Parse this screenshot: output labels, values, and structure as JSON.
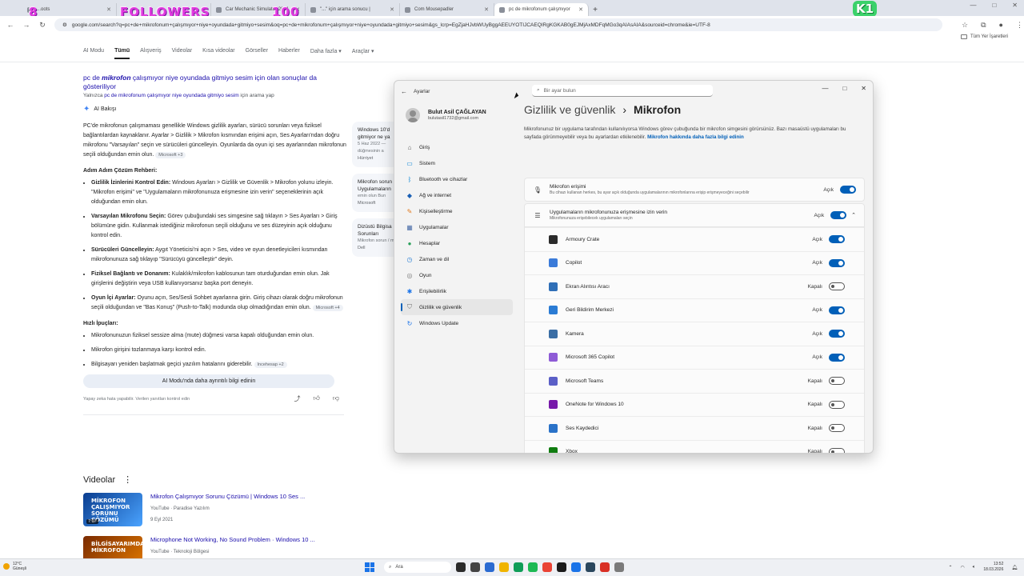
{
  "browser": {
    "tabs": [
      {
        "title": "...oots",
        "active": false
      },
      {
        "title": "Bu...",
        "active": false
      },
      {
        "title": "Car Mechanic Simulator 2021",
        "active": false
      },
      {
        "title": "\"...\" için arama sonucu |",
        "active": false
      },
      {
        "title": "Com Mousepadler",
        "active": false
      },
      {
        "title": "pc de mikrofonum çalışmıyor",
        "active": true
      }
    ],
    "new_tab": "+",
    "url": "google.com/search?q=pc+de+mikrofonum+çalışmıyor+niye+oyundada+gitmiyo+sesim&oq=pc+de+mikrofonum+çalışmıyor+niye+oyundada+gitmiyo+sesim&gs_lcrp=EgZjaHJvbWUyBggAEEUYOTIJCAEQIRgKGKAB0gEJMjAxMDFqMGo3qAIAsAIA&sourceid=chrome&ie=UTF-8",
    "bookmarks_label": "Tüm Yer İşaretleri"
  },
  "overlay": {
    "left_text": "FOLLOWERS",
    "left_num": "8",
    "right_num": "100",
    "k_badge": "K1"
  },
  "google": {
    "nav": [
      "AI Modu",
      "Tümü",
      "Alışveriş",
      "Videolar",
      "Kısa videolar",
      "Görseller",
      "Haberler",
      "Daha fazla ▾",
      "Araçlar ▾"
    ],
    "result_title_pre": "pc de ",
    "result_title_bold": "mikrofon",
    "result_title_post": " çalışmıyor niye oyundada gitmiyo sesim için olan sonuçlar da gösteriliyor",
    "result_sub_pre": "Yalnızca ",
    "result_sub_link": "pc de mikrofonum çalışmıyor niye oyundada gitmiyo sesim",
    "result_sub_post": " için arama yap",
    "ai_label": "AI Bakışı",
    "intro": "PC'de mikrofonun çalışmaması genellikle Windows gizlilik ayarları, sürücü sorunları veya fiziksel bağlantılardan kaynaklanır. Ayarlar > Gizlilik > Mikrofon kısmından erişimi açın, Ses Ayarları'ndan doğru mikrofonu \"Varsayılan\" seçin ve sürücüleri güncelleyin. Oyunlarda da oyun içi ses ayarlarından mikrofonun seçili olduğundan emin olun.",
    "intro_cite": "Microsoft +3",
    "steps_heading": "Adım Adım Çözüm Rehberi:",
    "steps": [
      {
        "bold": "Gizlilik İzinlerini Kontrol Edin:",
        "text": " Windows Ayarları > Gizlilik ve Güvenlik > Mikrofon yolunu izleyin. \"Mikrofon erişimi\" ve \"Uygulamaların mikrofonunuza erişmesine izin verin\" seçeneklerinin açık olduğundan emin olun.",
        "cite": ""
      },
      {
        "bold": "Varsayılan Mikrofonu Seçin:",
        "text": " Görev çubuğundaki ses simgesine sağ tıklayın > Ses Ayarları > Giriş bölümüne gidin. Kullanmak istediğiniz mikrofonun seçili olduğunu ve ses düzeyinin açık olduğunu kontrol edin.",
        "cite": ""
      },
      {
        "bold": "Sürücüleri Güncelleyin:",
        "text": " Aygıt Yöneticisi'ni açın > Ses, video ve oyun denetleyicileri kısmından mikrofonunuza sağ tıklayıp \"Sürücüyü güncelleştir\" deyin.",
        "cite": ""
      },
      {
        "bold": "Fiziksel Bağlantı ve Donanım:",
        "text": " Kulaklık/mikrofon kablosunun tam oturduğundan emin olun. Jak girişlerini değiştirin veya USB kullanıyorsanız başka port deneyin.",
        "cite": ""
      },
      {
        "bold": "Oyun İçi Ayarlar:",
        "text": " Oyunu açın, Ses/Sesli Sohbet ayarlarına girin. Giriş cihazı olarak doğru mikrofonun seçili olduğundan ve \"Bas Konuş\" (Push-to-Talk) modunda olup olmadığından emin olun.",
        "cite": "Microsoft +4"
      }
    ],
    "tips_heading": "Hızlı İpuçları:",
    "tips": [
      {
        "text": "Mikrofonunuzun fiziksel sessize alma (mute) düğmesi varsa kapalı olduğundan emin olun.",
        "cite": ""
      },
      {
        "text": "Mikrofon girişini tozlanmaya karşı kontrol edin.",
        "cite": ""
      },
      {
        "text": "Bilgisayarı yeniden başlatmak geçici yazılım hatalarını giderebilir.",
        "cite": "Incehesap +2"
      }
    ],
    "ai_more": "AI Modu'nda daha ayrıntılı bilgi edinin",
    "ai_disclaimer": "Yapay zeka hata yapabilir. Verilen yanıtları kontrol edin",
    "side_cards": [
      {
        "title": "Windows 10'd",
        "title2": "gitmiyor ne ya",
        "date": "5 Haz 2022 —",
        "snippet": "düğmesinin a",
        "source": "Hürriyet"
      },
      {
        "title": "Mikrofon sorun",
        "title2": "Uygulamaların",
        "date": "",
        "snippet": "emin olun Bun",
        "source": "Microsoft"
      },
      {
        "title": "Dizüstü Bilgisa",
        "title2": "Sorunları",
        "date": "",
        "snippet": "Mikrofon sorun / mikrofon kul",
        "source": "Dell"
      }
    ],
    "videos_heading": "Videolar",
    "videos": [
      {
        "title": "Mikrofon Çalışmıyor Sorunu Çözümü | Windows 10 Ses ...",
        "meta": "YouTube · Paradise Yazılım",
        "date": "9 Eyl 2021",
        "thumb_text": "MİKROFON ÇALIŞMIYOR SORUNU ÇÖZÜMÜ",
        "duration": "7:07"
      },
      {
        "title": "Microphone Not Working, No Sound Problem · Windows 10 ...",
        "meta": "YouTube · Teknoloji Bölgesi",
        "date": "",
        "thumb_text": "BİLGİSAYARIMDA MİKROFON",
        "duration": ""
      }
    ]
  },
  "settings": {
    "app_title": "Ayarlar",
    "search_placeholder": "Bir ayar bulun",
    "user_name": "Bulut Asil ÇAĞLAYAN",
    "user_email": "bulutasil1732@gmail.com",
    "nav": [
      {
        "label": "Giriş",
        "icon": "home-icon",
        "color": "#5a5a5a"
      },
      {
        "label": "Sistem",
        "icon": "system-icon",
        "color": "#0a84d6"
      },
      {
        "label": "Bluetooth ve cihazlar",
        "icon": "bluetooth-icon",
        "color": "#0a84d6"
      },
      {
        "label": "Ağ ve internet",
        "icon": "network-icon",
        "color": "#1a5fb4"
      },
      {
        "label": "Kişiselleştirme",
        "icon": "brush-icon",
        "color": "#e07a1f"
      },
      {
        "label": "Uygulamalar",
        "icon": "apps-icon",
        "color": "#4b6ea8"
      },
      {
        "label": "Hesaplar",
        "icon": "accounts-icon",
        "color": "#2aa05a"
      },
      {
        "label": "Zaman ve dil",
        "icon": "clock-icon",
        "color": "#2a7fd4"
      },
      {
        "label": "Oyun",
        "icon": "gamepad-icon",
        "color": "#7a7a7a"
      },
      {
        "label": "Erişilebilirlik",
        "icon": "accessibility-icon",
        "color": "#1a73e8"
      },
      {
        "label": "Gizlilik ve güvenlik",
        "icon": "shield-icon",
        "color": "#6b6b6b"
      },
      {
        "label": "Windows Update",
        "icon": "update-icon",
        "color": "#1a73e8"
      }
    ],
    "selected_nav": "Gizlilik ve güvenlik",
    "breadcrumb_parent": "Gizlilik ve güvenlik",
    "breadcrumb_sep": "›",
    "breadcrumb_current": "Mikrofon",
    "description": "Mikrofonunuz bir uygulama tarafından kullanılıyorsa Windows görev çubuğunda bir mikrofon simgesini görürsünüz. Bazı masaüstü uygulamaları bu sayfada görünmeyebilir veya bu ayarlardan etkilenebilir.",
    "description_link": "Mikrofon hakkında daha fazla bilgi edinin",
    "mic_access": {
      "title": "Mikrofon erişimi",
      "subtitle": "Bu cihazı kullanan herkes, bu ayar açık olduğunda uygulamalarının mikrofonlarına erişip erişmeyeceğini seçebilir",
      "state": "Açık",
      "on": true
    },
    "app_access": {
      "title": "Uygulamaların mikrofonunuza erişmesine izin verin",
      "subtitle": "Mikrofonunuza erişebilecek uygulamaları seçin",
      "state": "Açık",
      "on": true
    },
    "apps": [
      {
        "name": "Armoury Crate",
        "state": "Açık",
        "on": true,
        "color": "#2b2b2b"
      },
      {
        "name": "Copilot",
        "state": "Açık",
        "on": true,
        "color": "#3b7bd9"
      },
      {
        "name": "Ekran Alıntısı Aracı",
        "state": "Kapalı",
        "on": false,
        "color": "#2f6fb7"
      },
      {
        "name": "Geri Bildirim Merkezi",
        "state": "Açık",
        "on": true,
        "color": "#2a7bd4"
      },
      {
        "name": "Kamera",
        "state": "Açık",
        "on": true,
        "color": "#3a6ea5"
      },
      {
        "name": "Microsoft 365 Copilot",
        "state": "Açık",
        "on": true,
        "color": "#8e5bd6"
      },
      {
        "name": "Microsoft Teams",
        "state": "Kapalı",
        "on": false,
        "color": "#5b5fc7"
      },
      {
        "name": "OneNote for Windows 10",
        "state": "Kapalı",
        "on": false,
        "color": "#7719aa"
      },
      {
        "name": "Ses Kaydedici",
        "state": "Kapalı",
        "on": false,
        "color": "#2a72c8"
      },
      {
        "name": "Xbox",
        "state": "Kapalı",
        "on": false,
        "color": "#107c10"
      }
    ]
  },
  "taskbar": {
    "weather_temp": "12°C",
    "weather_desc": "Güneşli",
    "search_label": "Ara",
    "time": "13:52",
    "date": "18.03.2026",
    "apps": [
      "#2b2b2b",
      "#444444",
      "#2a6ad1",
      "#f0b400",
      "#0f9d58",
      "#1db954",
      "#ea4335",
      "#1b1b1b",
      "#1a73e8",
      "#2a475e",
      "#d93025",
      "#7a7a7a"
    ]
  }
}
